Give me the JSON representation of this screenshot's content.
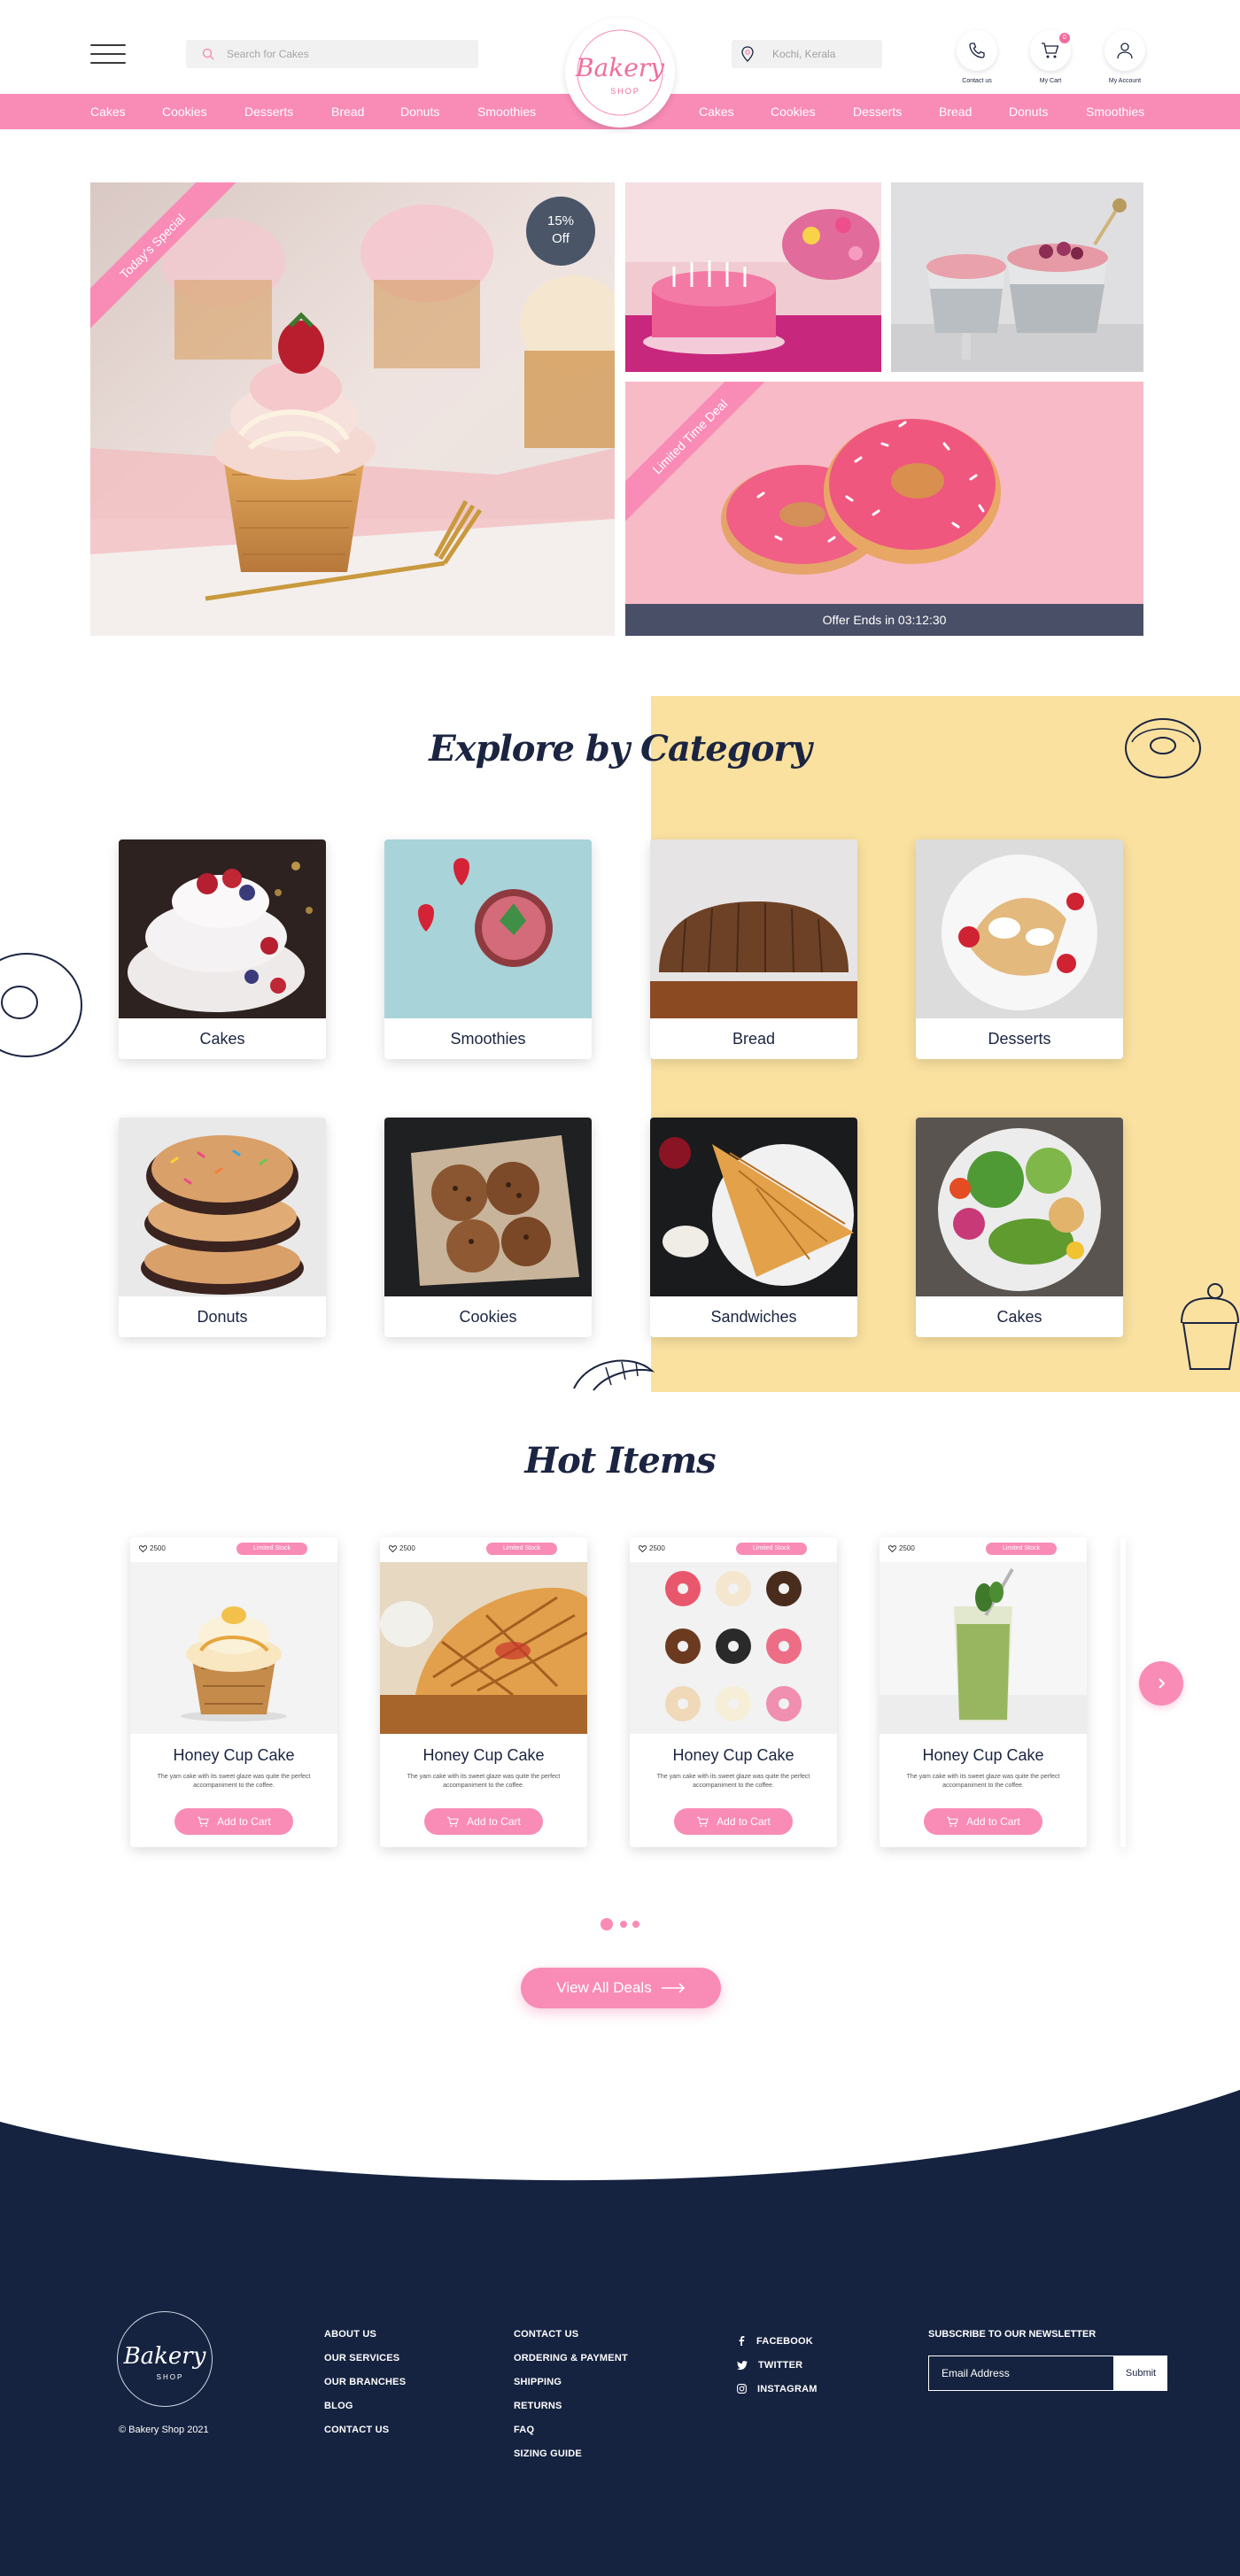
{
  "header": {
    "search_placeholder": "Search for Cakes",
    "location": "Kochi, Kerala",
    "contact_label": "Contact us",
    "cart_label": "My Cart",
    "cart_count": "0",
    "account_label": "My Account"
  },
  "logo": {
    "title": "Bakery",
    "subtitle": "SHOP"
  },
  "nav": {
    "left": [
      "Cakes",
      "Cookies",
      "Desserts",
      "Bread",
      "Donuts",
      "Smoothies"
    ],
    "right": [
      "Cakes",
      "Cookies",
      "Desserts",
      "Bread",
      "Donuts",
      "Smoothies"
    ]
  },
  "hero": {
    "special_ribbon": "Today's Special",
    "discount_line1": "15%",
    "discount_line2": "Off",
    "deal_ribbon": "Limited Time Deal",
    "offer_text": "Offer Ends in 03:12:30"
  },
  "categories": {
    "title": "Explore by Category",
    "items": [
      "Cakes",
      "Smoothies",
      "Bread",
      "Desserts",
      "Donuts",
      "Cookies",
      "Sandwiches",
      "Cakes"
    ]
  },
  "hot_items": {
    "title": "Hot Items",
    "products": [
      {
        "likes": "2500",
        "stock": "Limited Stock",
        "name": "Honey Cup Cake",
        "desc": "The yam cake with its sweet glaze was quite the perfect accompaniment to the coffee.",
        "button": "Add to Cart"
      },
      {
        "likes": "2500",
        "stock": "Limited Stock",
        "name": "Honey Cup Cake",
        "desc": "The yam cake with its sweet glaze was quite the perfect accompaniment to the coffee.",
        "button": "Add to Cart"
      },
      {
        "likes": "2500",
        "stock": "Limited Stock",
        "name": "Honey Cup Cake",
        "desc": "The yam cake with its sweet glaze was quite the perfect accompaniment to the coffee.",
        "button": "Add to Cart"
      },
      {
        "likes": "2500",
        "stock": "Limited Stock",
        "name": "Honey Cup Cake",
        "desc": "The yam cake with its sweet glaze was quite the perfect accompaniment to the coffee.",
        "button": "Add to Cart"
      }
    ],
    "view_all": "View All Deals"
  },
  "footer": {
    "copyright": "© Bakery Shop 2021",
    "col1": [
      "ABOUT US",
      "OUR SERVICES",
      "OUR BRANCHES",
      "BLOG",
      "CONTACT US"
    ],
    "col2": [
      "CONTACT US",
      "ORDERING & PAYMENT",
      "SHIPPING",
      "RETURNS",
      "FAQ",
      "SIZING GUIDE"
    ],
    "social": [
      "FACEBOOK",
      "TWITTER",
      "INSTAGRAM"
    ],
    "newsletter_title": "SUBSCRIBE TO OUR NEWSLETTER",
    "email_placeholder": "Email Address",
    "submit": "Submit"
  },
  "colors": {
    "pink": "#f88cb7",
    "navy": "#1b2541",
    "yellow": "#fae1a0"
  }
}
